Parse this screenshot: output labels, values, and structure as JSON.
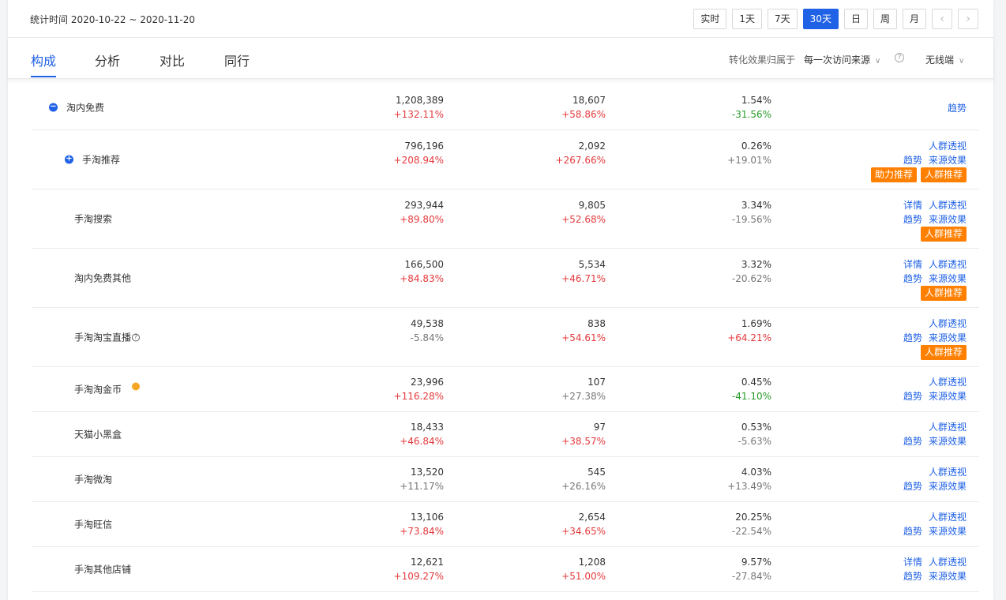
{
  "header": {
    "stat_range": "统计时间 2020-10-22 ~ 2020-11-20",
    "period_buttons": [
      "实时",
      "1天",
      "7天",
      "30天",
      "日",
      "周",
      "月"
    ],
    "active_period": "30天",
    "prev_arrow": "‹",
    "next_arrow": "›"
  },
  "tabs": [
    "构成",
    "分析",
    "对比",
    "同行"
  ],
  "active_tab": "构成",
  "attribution": {
    "label": "转化效果归属于",
    "selected": "每一次访问来源",
    "help": "?"
  },
  "device": {
    "selected": "无线端"
  },
  "colors": {
    "accent": "#2062e6",
    "up": "#e4393c",
    "down": "#2a9b2a",
    "badge": "#ff7f00"
  },
  "rows": [
    {
      "name": "淘内免费",
      "toggle": "−",
      "m1": [
        "1,208,389",
        "+132.11%"
      ],
      "m2": [
        "18,607",
        "+58.86%"
      ],
      "m3": [
        "1.54%",
        "-31.56%"
      ]
    },
    {
      "name": "手淘推荐",
      "toggle": "+",
      "m1": [
        "796,196",
        "+208.94%"
      ],
      "m2": [
        "2,092",
        "+267.66%"
      ],
      "m3": [
        "0.26%",
        "+19.01%"
      ],
      "links1": [
        "人群透视"
      ],
      "links2": [
        "趋势",
        "来源效果"
      ],
      "badges": [
        "助力推荐",
        "人群推荐"
      ]
    },
    {
      "name": "手淘搜索",
      "m1": [
        "293,944",
        "+89.80%"
      ],
      "m2": [
        "9,805",
        "+52.68%"
      ],
      "m3": [
        "3.34%",
        "-19.56%"
      ],
      "links1": [
        "详情",
        "人群透视"
      ],
      "links2": [
        "趋势",
        "来源效果"
      ],
      "badges": [
        "人群推荐"
      ]
    },
    {
      "name": "淘内免费其他",
      "m1": [
        "166,500",
        "+84.83%"
      ],
      "m2": [
        "5,534",
        "+46.71%"
      ],
      "m3": [
        "3.32%",
        "-20.62%"
      ],
      "links1": [
        "详情",
        "人群透视"
      ],
      "links2": [
        "趋势",
        "来源效果"
      ],
      "badges": [
        "人群推荐"
      ]
    },
    {
      "name": "手淘淘宝直播",
      "help": "?",
      "m1": [
        "49,538",
        "-5.84%"
      ],
      "m2": [
        "838",
        "+54.61%"
      ],
      "m3": [
        "1.69%",
        "+64.21%"
      ],
      "links1": [
        "人群透视"
      ],
      "links2": [
        "趋势",
        "来源效果"
      ],
      "badges": [
        "人群推荐"
      ]
    },
    {
      "name": "手淘淘金币",
      "dot": true,
      "m1": [
        "23,996",
        "+116.28%"
      ],
      "m2": [
        "107",
        "+27.38%"
      ],
      "m3": [
        "0.45%",
        "-41.10%"
      ],
      "links1": [
        "人群透视"
      ],
      "links2": [
        "趋势",
        "来源效果"
      ]
    },
    {
      "name": "天猫小黑盒",
      "m1": [
        "18,433",
        "+46.84%"
      ],
      "m2": [
        "97",
        "+38.57%"
      ],
      "m3": [
        "0.53%",
        "-5.63%"
      ],
      "links1": [
        "人群透视"
      ],
      "links2": [
        "趋势",
        "来源效果"
      ]
    },
    {
      "name": "手淘微淘",
      "m1": [
        "13,520",
        "+11.17%"
      ],
      "m2": [
        "545",
        "+26.16%"
      ],
      "m3": [
        "4.03%",
        "+13.49%"
      ],
      "links1": [
        "人群透视"
      ],
      "links2": [
        "趋势",
        "来源效果"
      ]
    },
    {
      "name": "手淘旺信",
      "m1": [
        "13,106",
        "+73.84%"
      ],
      "m2": [
        "2,654",
        "+34.65%"
      ],
      "m3": [
        "20.25%",
        "-22.54%"
      ],
      "links1": [
        "人群透视"
      ],
      "links2": [
        "趋势",
        "来源效果"
      ]
    },
    {
      "name": "手淘其他店铺",
      "m1": [
        "12,621",
        "+109.27%"
      ],
      "m2": [
        "1,208",
        "+51.00%"
      ],
      "m3": [
        "9.57%",
        "-27.84%"
      ],
      "links1": [
        "详情",
        "人群透视"
      ],
      "links2": [
        "趋势",
        "来源效果"
      ]
    }
  ]
}
